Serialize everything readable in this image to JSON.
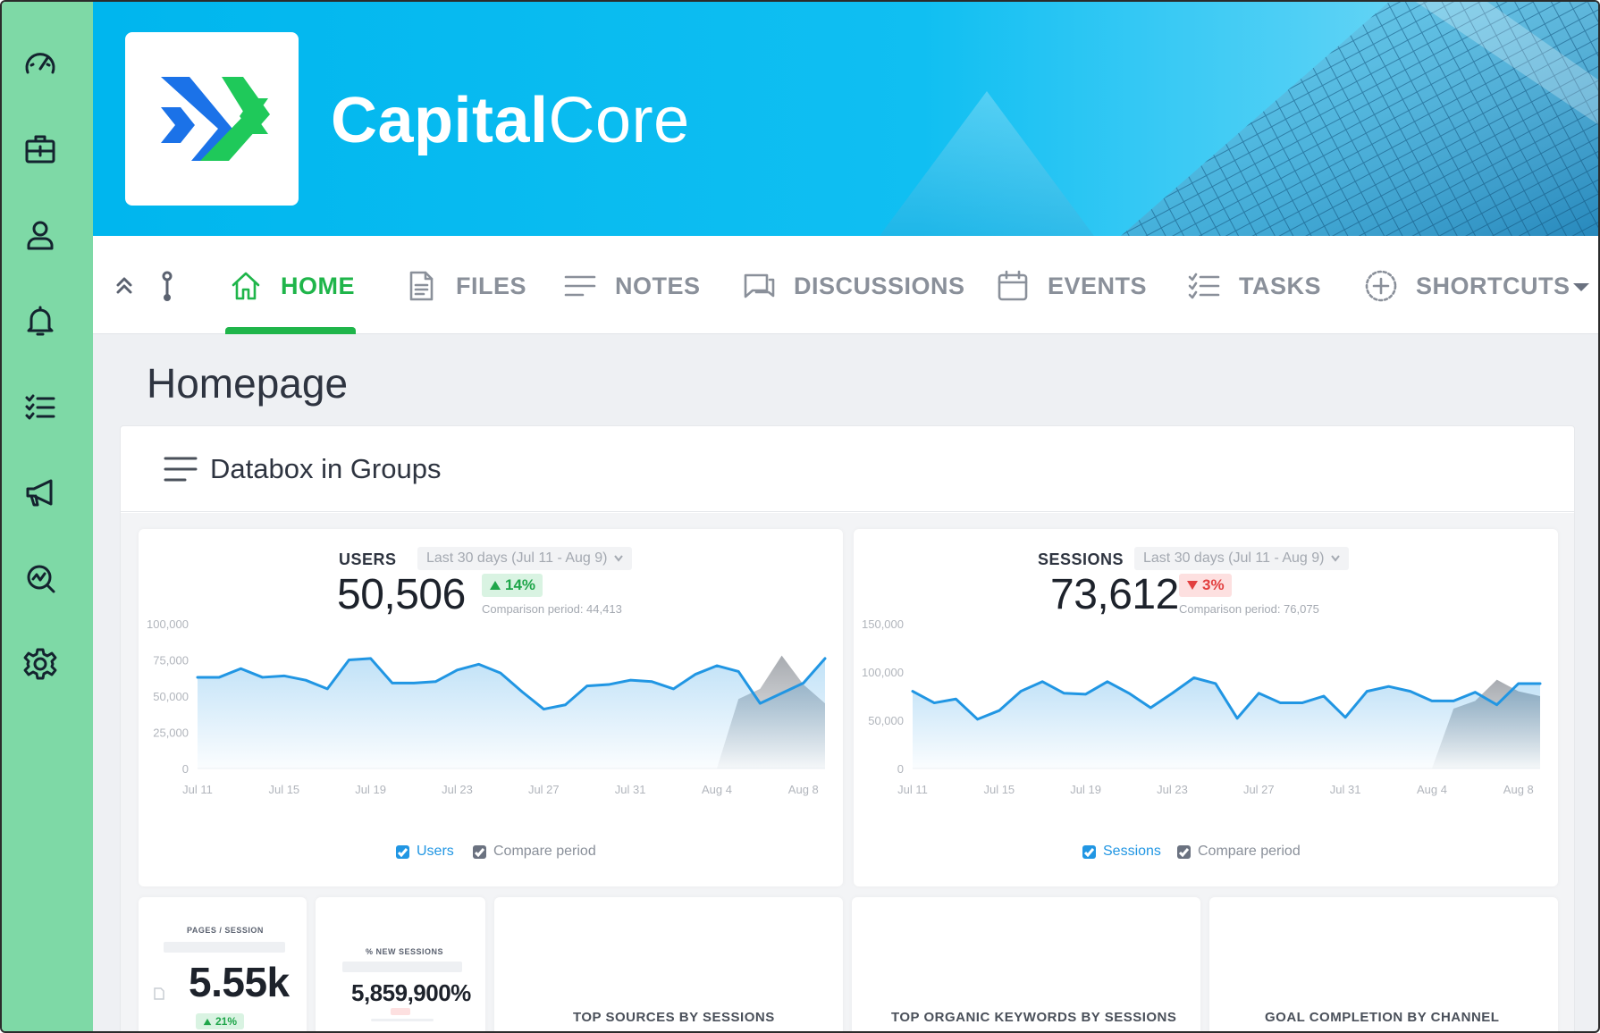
{
  "app": {
    "brand_bold": "Capital",
    "brand_light": "Core",
    "colors": {
      "accent": "#1fb54a",
      "rail": "#7ed9a6",
      "banner": "#00b6ee",
      "up": "#1fa64a",
      "down": "#e24040",
      "series": "#2196e3"
    }
  },
  "rail": {
    "icons": [
      "speedometer-icon",
      "toolbox-icon",
      "user-icon",
      "bell-icon",
      "checklist-icon",
      "megaphone-icon",
      "analytics-icon",
      "gear-icon"
    ]
  },
  "nav": {
    "tabs": [
      {
        "label": "HOME",
        "icon": "home-icon",
        "active": true
      },
      {
        "label": "FILES",
        "icon": "file-icon",
        "active": false
      },
      {
        "label": "NOTES",
        "icon": "notes-icon",
        "active": false
      },
      {
        "label": "DISCUSSIONS",
        "icon": "discussion-icon",
        "active": false
      },
      {
        "label": "EVENTS",
        "icon": "calendar-icon",
        "active": false
      },
      {
        "label": "TASKS",
        "icon": "tasks-icon",
        "active": false
      },
      {
        "label": "SHORTCUTS",
        "icon": "plus-circle-icon",
        "active": false
      }
    ]
  },
  "page": {
    "title": "Homepage",
    "panel_title": "Databox in Groups"
  },
  "users": {
    "label": "USERS",
    "range": "Last 30 days (Jul 11 - Aug 9)",
    "value": "50,506",
    "change": "14%",
    "comparison": "Comparison period: 44,413",
    "legend_main": "Users",
    "legend_compare": "Compare period"
  },
  "sessions": {
    "label": "SESSIONS",
    "range": "Last 30 days (Jul 11 - Aug 9)",
    "value": "73,612",
    "change": "3%",
    "comparison": "Comparison period: 76,075",
    "legend_main": "Sessions",
    "legend_compare": "Compare period"
  },
  "small_cards": {
    "pages_session": {
      "title": "PAGES / SESSION",
      "value": "5.55k",
      "change": "21%"
    },
    "new_sessions": {
      "title": "% NEW SESSIONS",
      "value": "5,859,900%"
    },
    "top_sources": "TOP SOURCES BY SESSIONS",
    "top_keywords": "TOP ORGANIC KEYWORDS BY SESSIONS",
    "goal_completion": "GOAL COMPLETION BY CHANNEL"
  },
  "chart_data": [
    {
      "type": "line",
      "title": "USERS",
      "x": [
        "Jul 11",
        "Jul 12",
        "Jul 13",
        "Jul 14",
        "Jul 15",
        "Jul 16",
        "Jul 17",
        "Jul 18",
        "Jul 19",
        "Jul 20",
        "Jul 21",
        "Jul 22",
        "Jul 23",
        "Jul 24",
        "Jul 25",
        "Jul 26",
        "Jul 27",
        "Jul 28",
        "Jul 29",
        "Jul 30",
        "Jul 31",
        "Aug 1",
        "Aug 2",
        "Aug 3",
        "Aug 4",
        "Aug 5",
        "Aug 6",
        "Aug 7",
        "Aug 8",
        "Aug 9"
      ],
      "xticks": [
        "Jul 11",
        "Jul 15",
        "Jul 19",
        "Jul 23",
        "Jul 27",
        "Jul 31",
        "Aug 4",
        "Aug 8"
      ],
      "yticks": [
        "0",
        "25,000",
        "50,000",
        "75,000",
        "100,000"
      ],
      "ylim": [
        0,
        100000
      ],
      "series": [
        {
          "name": "Users",
          "values": [
            63000,
            63000,
            69000,
            63000,
            64000,
            61000,
            55000,
            75000,
            76000,
            59000,
            59000,
            60000,
            68000,
            72000,
            66000,
            53000,
            41000,
            44000,
            57000,
            58000,
            61000,
            60000,
            55000,
            65000,
            71000,
            67000,
            45000,
            52000,
            59000,
            76000
          ]
        },
        {
          "name": "Compare period",
          "values": [
            0,
            0,
            0,
            0,
            0,
            0,
            0,
            0,
            0,
            0,
            0,
            0,
            0,
            0,
            0,
            0,
            0,
            0,
            0,
            0,
            0,
            0,
            0,
            0,
            0,
            48000,
            55000,
            78000,
            58000,
            45000
          ]
        }
      ]
    },
    {
      "type": "line",
      "title": "SESSIONS",
      "x": [
        "Jul 11",
        "Jul 12",
        "Jul 13",
        "Jul 14",
        "Jul 15",
        "Jul 16",
        "Jul 17",
        "Jul 18",
        "Jul 19",
        "Jul 20",
        "Jul 21",
        "Jul 22",
        "Jul 23",
        "Jul 24",
        "Jul 25",
        "Jul 26",
        "Jul 27",
        "Jul 28",
        "Jul 29",
        "Jul 30",
        "Jul 31",
        "Aug 1",
        "Aug 2",
        "Aug 3",
        "Aug 4",
        "Aug 5",
        "Aug 6",
        "Aug 7",
        "Aug 8",
        "Aug 9"
      ],
      "xticks": [
        "Jul 11",
        "Jul 15",
        "Jul 19",
        "Jul 23",
        "Jul 27",
        "Jul 31",
        "Aug 4",
        "Aug 8"
      ],
      "yticks": [
        "0",
        "50,000",
        "100,000",
        "150,000"
      ],
      "ylim": [
        0,
        150000
      ],
      "series": [
        {
          "name": "Sessions",
          "values": [
            80000,
            68000,
            72000,
            51000,
            60000,
            80000,
            90000,
            78000,
            77000,
            90000,
            78000,
            63000,
            78000,
            94000,
            88000,
            52000,
            78000,
            68000,
            68000,
            75000,
            53000,
            80000,
            85000,
            80000,
            70000,
            70000,
            79000,
            66000,
            88000,
            88000
          ]
        },
        {
          "name": "Compare period",
          "values": [
            0,
            0,
            0,
            0,
            0,
            0,
            0,
            0,
            0,
            0,
            0,
            0,
            0,
            0,
            0,
            0,
            0,
            0,
            0,
            0,
            0,
            0,
            0,
            0,
            0,
            62000,
            70000,
            92000,
            80000,
            75000
          ]
        }
      ]
    }
  ]
}
